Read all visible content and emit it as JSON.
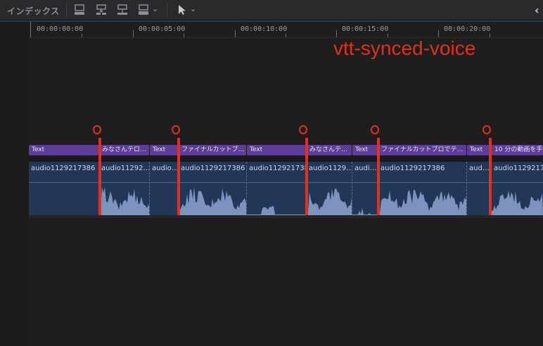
{
  "toolbar": {
    "index_label": "インデックス",
    "icons": [
      "append-clip-icon",
      "insert-clip-icon",
      "connect-clip-icon",
      "overwrite-clip-icon",
      "select-tool-icon"
    ]
  },
  "ruler": {
    "timecodes": [
      "00:00:00:00",
      "00:00:05:00",
      "00:00:10:00",
      "00:00:15:00",
      "00:00:20:00"
    ]
  },
  "annotation": {
    "text": "vtt-synced-voice",
    "color": "#e3301e"
  },
  "title_clips": [
    {
      "label": "Text"
    },
    {
      "label": "みなさんテロ…"
    },
    {
      "label": "Text"
    },
    {
      "label": "ファイナルカットプ…"
    },
    {
      "label": "Text"
    },
    {
      "label": "みなさんテ…"
    },
    {
      "label": "Text"
    },
    {
      "label": "ファイナルカットプロでテ…"
    },
    {
      "label": "Text"
    },
    {
      "label": "10 分の動画を手作"
    }
  ],
  "audio_clips": [
    {
      "label": "audio1129217386"
    },
    {
      "label": "audio11292…"
    },
    {
      "label": "audio…"
    },
    {
      "label": "audio1129217386"
    },
    {
      "label": "audio1129217386"
    },
    {
      "label": "audio1129…"
    },
    {
      "label": "audi…"
    },
    {
      "label": "audio1129217386"
    },
    {
      "label": "aud…"
    },
    {
      "label": "audio11292173"
    }
  ],
  "colors": {
    "title_clip": "#5e3d99",
    "audio_clip": "#223657",
    "marker": "#e3301e"
  }
}
